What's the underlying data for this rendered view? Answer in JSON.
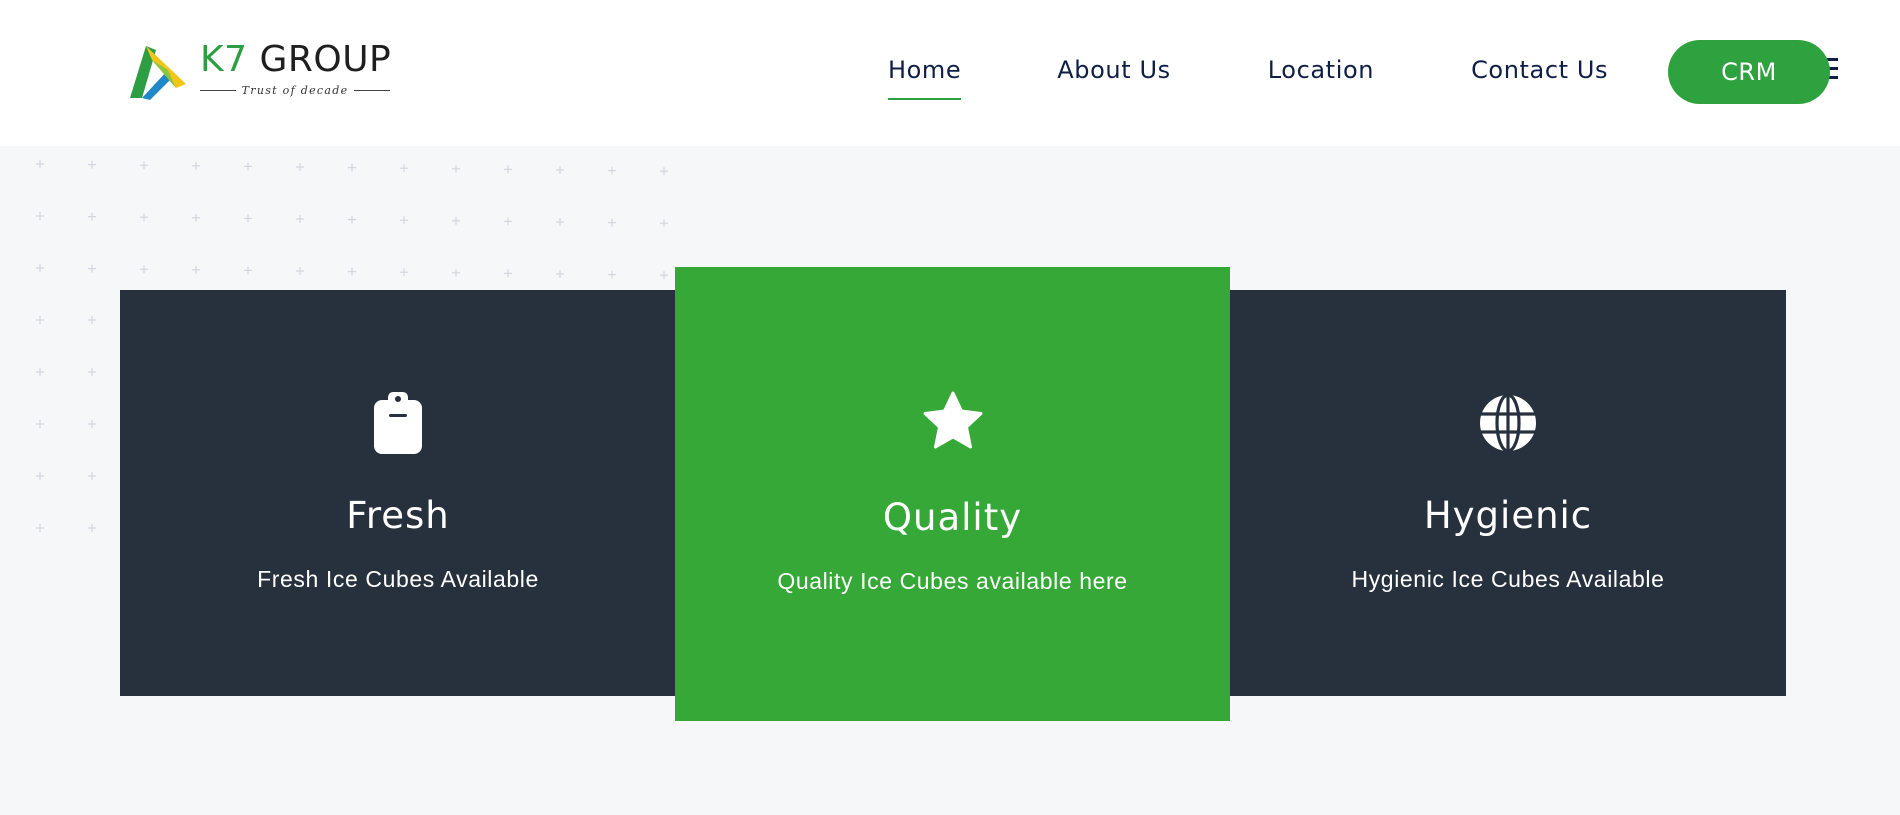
{
  "brand": {
    "name_part1": "K7",
    "name_part2": " GROUP",
    "tagline": "Trust of decade",
    "colors": {
      "green": "#2e9e44",
      "navy": "#0f1e46",
      "dark_card": "#27313d",
      "green_card": "#36a837"
    }
  },
  "nav": {
    "items": [
      {
        "label": "Home",
        "active": true
      },
      {
        "label": "About Us",
        "active": false
      },
      {
        "label": "Location",
        "active": false
      },
      {
        "label": "Contact Us",
        "active": false
      }
    ],
    "crm_label": "CRM",
    "menu_icon": "hamburger-icon"
  },
  "features": [
    {
      "icon": "clipboard-icon",
      "title": "Fresh",
      "subtitle": "Fresh Ice Cubes Available"
    },
    {
      "icon": "star-icon",
      "title": "Quality",
      "subtitle": "Quality Ice Cubes available here"
    },
    {
      "icon": "globe-icon",
      "title": "Hygienic",
      "subtitle": "Hygienic Ice Cubes Available"
    }
  ]
}
